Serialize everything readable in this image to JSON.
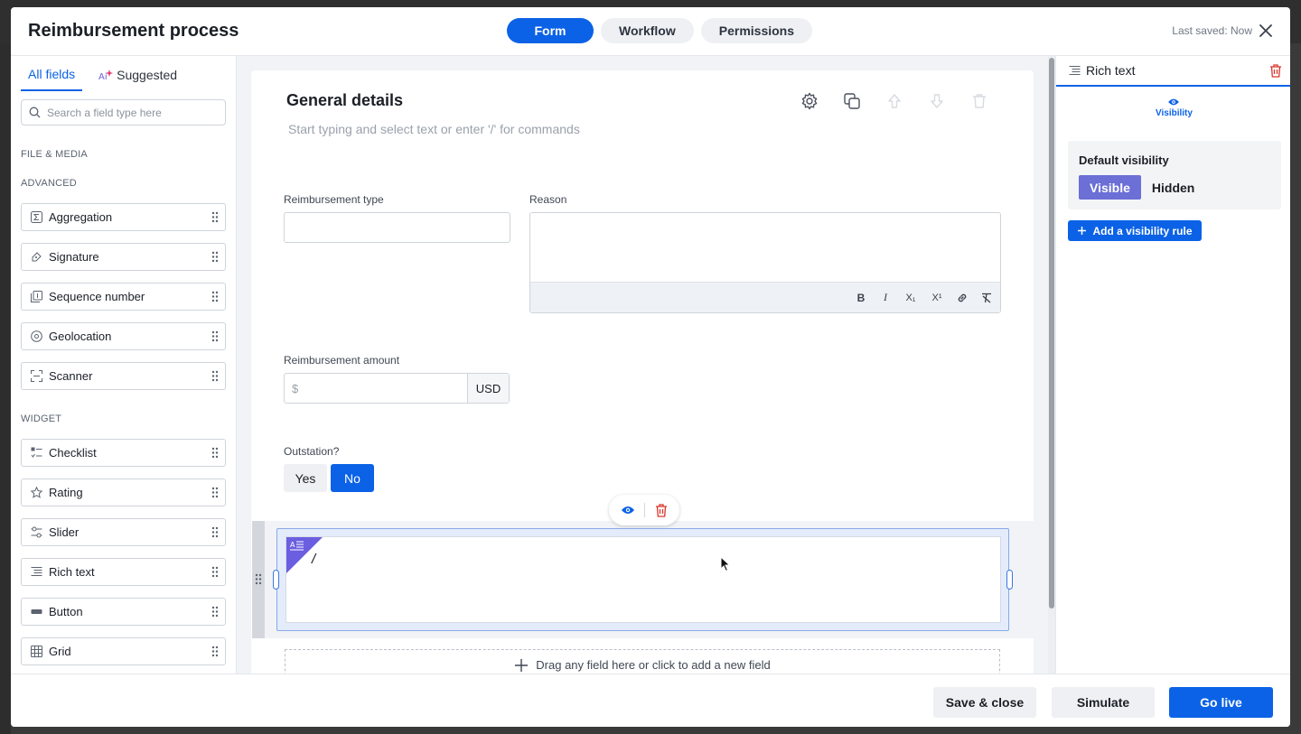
{
  "header": {
    "title": "Reimbursement process",
    "tabs": [
      {
        "label": "Form",
        "active": true
      },
      {
        "label": "Workflow",
        "active": false
      },
      {
        "label": "Permissions",
        "active": false
      }
    ],
    "last_saved": "Last saved: Now"
  },
  "left_panel": {
    "tabs": [
      {
        "label": "All fields",
        "active": true
      },
      {
        "label": "Suggested",
        "active": false,
        "icon": "ai-sparkle-icon"
      }
    ],
    "search_placeholder": "Search a field type here",
    "sections": {
      "file_media": "FILE & MEDIA",
      "advanced": "ADVANCED",
      "widget": "WIDGET"
    },
    "advanced_items": [
      {
        "label": "Aggregation",
        "icon": "sigma-icon"
      },
      {
        "label": "Signature",
        "icon": "signature-icon"
      },
      {
        "label": "Sequence number",
        "icon": "sequence-icon"
      },
      {
        "label": "Geolocation",
        "icon": "location-pin-icon"
      },
      {
        "label": "Scanner",
        "icon": "scanner-icon"
      }
    ],
    "widget_items": [
      {
        "label": "Checklist",
        "icon": "checklist-icon"
      },
      {
        "label": "Rating",
        "icon": "star-icon"
      },
      {
        "label": "Slider",
        "icon": "slider-icon"
      },
      {
        "label": "Rich text",
        "icon": "rich-text-icon"
      },
      {
        "label": "Button",
        "icon": "button-icon"
      },
      {
        "label": "Grid",
        "icon": "grid-icon"
      }
    ]
  },
  "form": {
    "section_title": "General details",
    "section_placeholder": "Start typing and select text or enter '/' for commands",
    "fields": {
      "reimbursement_type_label": "Reimbursement type",
      "reason_label": "Reason",
      "amount_label": "Reimbursement amount",
      "amount_placeholder": "$",
      "currency": "USD",
      "outstation_label": "Outstation?",
      "outstation_yes": "Yes",
      "outstation_no": "No",
      "outstation_selected": "No"
    },
    "richtext_toolbar": [
      "B",
      "I",
      "X₁",
      "X¹",
      "link",
      "clear"
    ],
    "selected_block_text": "/",
    "dropzone_text": "Drag any field here or click to add a new field"
  },
  "properties": {
    "title": "Rich text",
    "tab": "Visibility",
    "default_visibility_label": "Default visibility",
    "visible_label": "Visible",
    "hidden_label": "Hidden",
    "selected": "Visible",
    "add_rule_label": "Add a visibility rule"
  },
  "footer": {
    "save_close": "Save & close",
    "simulate": "Simulate",
    "go_live": "Go live"
  },
  "colors": {
    "accent": "#0b62e6",
    "visibility_selected": "#6b6fd6",
    "delete": "#d9342b"
  }
}
